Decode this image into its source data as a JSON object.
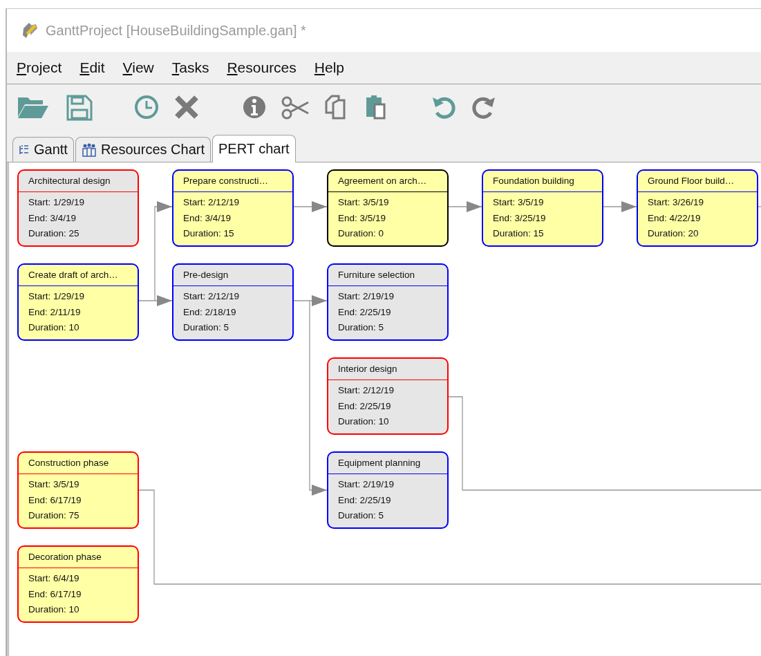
{
  "window": {
    "title": "GanttProject [HouseBuildingSample.gan] *"
  },
  "menu": [
    "Project",
    "Edit",
    "View",
    "Tasks",
    "Resources",
    "Help"
  ],
  "tabs": [
    {
      "label": "Gantt",
      "selected": false,
      "kind": "gantt"
    },
    {
      "label": "Resources Chart",
      "selected": false,
      "kind": "resources"
    },
    {
      "label": "PERT chart",
      "selected": true,
      "kind": "pert"
    }
  ],
  "pert_nodes": [
    {
      "title": "Architectural design",
      "start": "Start: 1/29/19",
      "end": "End: 3/4/19",
      "duration": "Duration: 25",
      "color": "#ff0000",
      "kind": "shaded"
    },
    {
      "title": "Prepare constructi…",
      "start": "Start: 2/12/19",
      "end": "End: 3/4/19",
      "duration": "Duration: 15",
      "color": "#0000ff",
      "kind": "normal"
    },
    {
      "title": "Agreement on arch…",
      "start": "Start: 3/5/19",
      "end": "End: 3/5/19",
      "duration": "Duration: 0",
      "color": "#000000",
      "kind": "normal"
    },
    {
      "title": "Foundation building",
      "start": "Start: 3/5/19",
      "end": "End: 3/25/19",
      "duration": "Duration: 15",
      "color": "#0000ff",
      "kind": "normal"
    },
    {
      "title": "Ground Floor build…",
      "start": "Start: 3/26/19",
      "end": "End: 4/22/19",
      "duration": "Duration: 20",
      "color": "#0000ff",
      "kind": "normal"
    },
    {
      "title": "Create draft of arch…",
      "start": "Start: 1/29/19",
      "end": "End: 2/11/19",
      "duration": "Duration: 10",
      "color": "#0000ff",
      "kind": "normal"
    },
    {
      "title": "Pre-design",
      "start": "Start: 2/12/19",
      "end": "End: 2/18/19",
      "duration": "Duration: 5",
      "color": "#0000ff",
      "kind": "shaded"
    },
    {
      "title": "Furniture selection",
      "start": "Start: 2/19/19",
      "end": "End: 2/25/19",
      "duration": "Duration: 5",
      "color": "#0000ff",
      "kind": "shaded"
    },
    {
      "title": "Interior design",
      "start": "Start: 2/12/19",
      "end": "End: 2/25/19",
      "duration": "Duration: 10",
      "color": "#ff0000",
      "kind": "shaded"
    },
    {
      "title": "Construction phase",
      "start": "Start: 3/5/19",
      "end": "End: 6/17/19",
      "duration": "Duration: 75",
      "color": "#ff0000",
      "kind": "normal"
    },
    {
      "title": "Equipment planning",
      "start": "Start: 2/19/19",
      "end": "End: 2/25/19",
      "duration": "Duration: 5",
      "color": "#0000ff",
      "kind": "shaded"
    },
    {
      "title": "Decoration phase",
      "start": "Start: 6/4/19",
      "end": "End: 6/17/19",
      "duration": "Duration: 10",
      "color": "#ff0000",
      "kind": "normal"
    }
  ]
}
